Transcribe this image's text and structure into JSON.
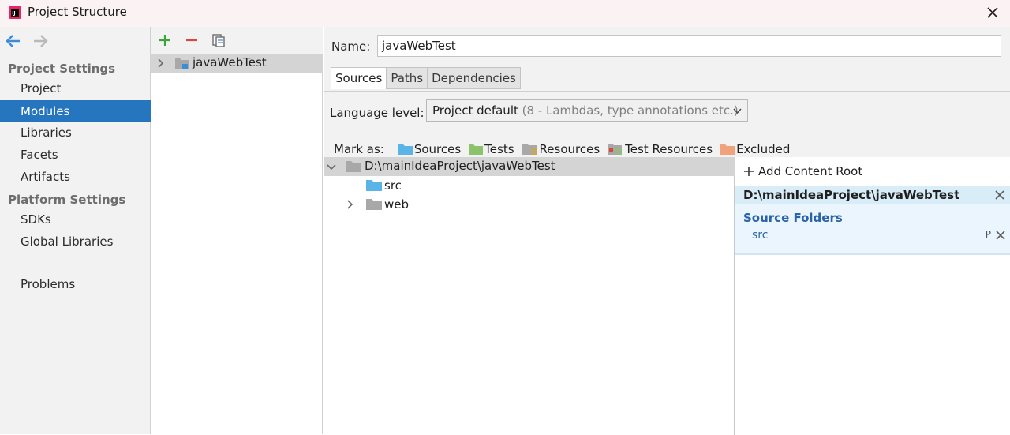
{
  "window": {
    "title": "Project Structure"
  },
  "sidebar": {
    "project_settings_heading": "Project Settings",
    "project_items": [
      {
        "label": "Project",
        "selected": false
      },
      {
        "label": "Modules",
        "selected": true
      },
      {
        "label": "Libraries",
        "selected": false
      },
      {
        "label": "Facets",
        "selected": false
      },
      {
        "label": "Artifacts",
        "selected": false
      }
    ],
    "platform_settings_heading": "Platform Settings",
    "platform_items": [
      {
        "label": "SDKs"
      },
      {
        "label": "Global Libraries"
      }
    ],
    "problems_label": "Problems"
  },
  "modules": {
    "list": [
      {
        "label": "javaWebTest"
      }
    ]
  },
  "detail": {
    "name_label": "Name:",
    "name_value": "javaWebTest",
    "tabs": [
      {
        "label": "Sources",
        "active": true
      },
      {
        "label": "Paths",
        "active": false
      },
      {
        "label": "Dependencies",
        "active": false
      }
    ],
    "language_level_label": "Language level:",
    "language_level_value": "Project default",
    "language_level_hint": "(8 - Lambdas, type annotations etc.)",
    "mark_as_label": "Mark as:",
    "mark_as": [
      {
        "label": "Sources",
        "color": "#5ab4e6"
      },
      {
        "label": "Tests",
        "color": "#8bc36b"
      },
      {
        "label": "Resources",
        "color": "#9e9e9e"
      },
      {
        "label": "Test Resources",
        "color": "#9e9e9e"
      },
      {
        "label": "Excluded",
        "color": "#f0a27a"
      }
    ],
    "tree": {
      "root": "D:\\mainIdeaProject\\javaWebTest",
      "children": [
        {
          "label": "src",
          "color": "#5ab4e6"
        },
        {
          "label": "web",
          "color": "#a8a8a8"
        }
      ]
    },
    "content_root": {
      "add_label": "Add Content Root",
      "path": "D:\\mainIdeaProject\\javaWebTest",
      "source_folders_heading": "Source Folders",
      "source_folders": [
        "src"
      ],
      "properties_glyph": "P"
    }
  }
}
